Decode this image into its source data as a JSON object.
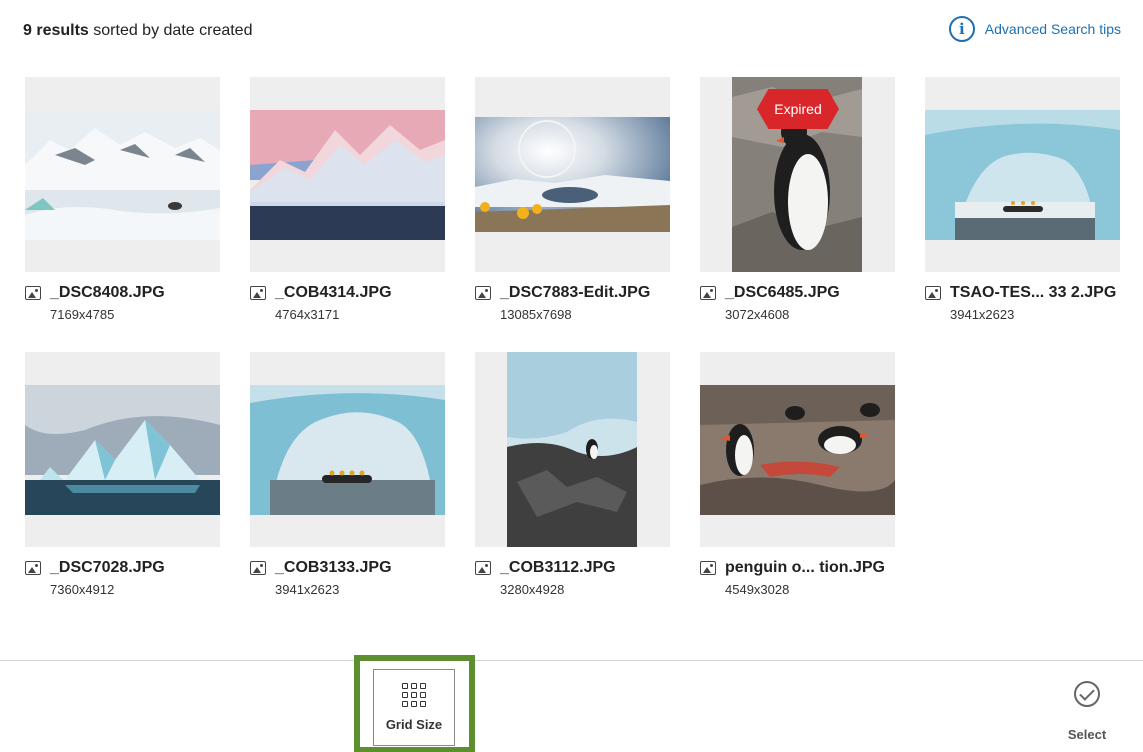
{
  "summary": {
    "count": "9 results",
    "sort_text": "sorted by date created"
  },
  "tips": {
    "label": "Advanced Search tips",
    "icon": "info-icon"
  },
  "assets": [
    {
      "name": "_DSC8408.JPG",
      "dims": "7169x4785",
      "orientation": "landscape",
      "theme": "snow-seal"
    },
    {
      "name": "_COB4314.JPG",
      "dims": "4764x3171",
      "orientation": "landscape",
      "theme": "pink-mountains"
    },
    {
      "name": "_DSC7883-Edit.JPG",
      "dims": "13085x7698",
      "orientation": "landscape",
      "theme": "sun-halo"
    },
    {
      "name": "_DSC6485.JPG",
      "dims": "3072x4608",
      "orientation": "portrait",
      "theme": "penguin-rock",
      "badge": "Expired"
    },
    {
      "name": "TSAO-TES... 33 2.JPG",
      "dims": "3941x2623",
      "orientation": "landscape",
      "theme": "ice-arch"
    },
    {
      "name": "_DSC7028.JPG",
      "dims": "7360x4912",
      "orientation": "landscape",
      "theme": "iceberg"
    },
    {
      "name": "_COB3133.JPG",
      "dims": "3941x2623",
      "orientation": "landscape",
      "theme": "ice-arch-boat"
    },
    {
      "name": "_COB3112.JPG",
      "dims": "3280x4928",
      "orientation": "portrait",
      "theme": "penguin-cliff"
    },
    {
      "name": "penguin o... tion.JPG",
      "dims": "4549x3028",
      "orientation": "landscape",
      "theme": "penguin-colony"
    }
  ],
  "toolbar": {
    "grid_size_label": "Grid Size",
    "select_label": "Select"
  },
  "colors": {
    "accent": "#1f6fb2",
    "highlight": "#5d8f2e",
    "expired": "#d9262b",
    "placeholder": "#eeeeee"
  }
}
